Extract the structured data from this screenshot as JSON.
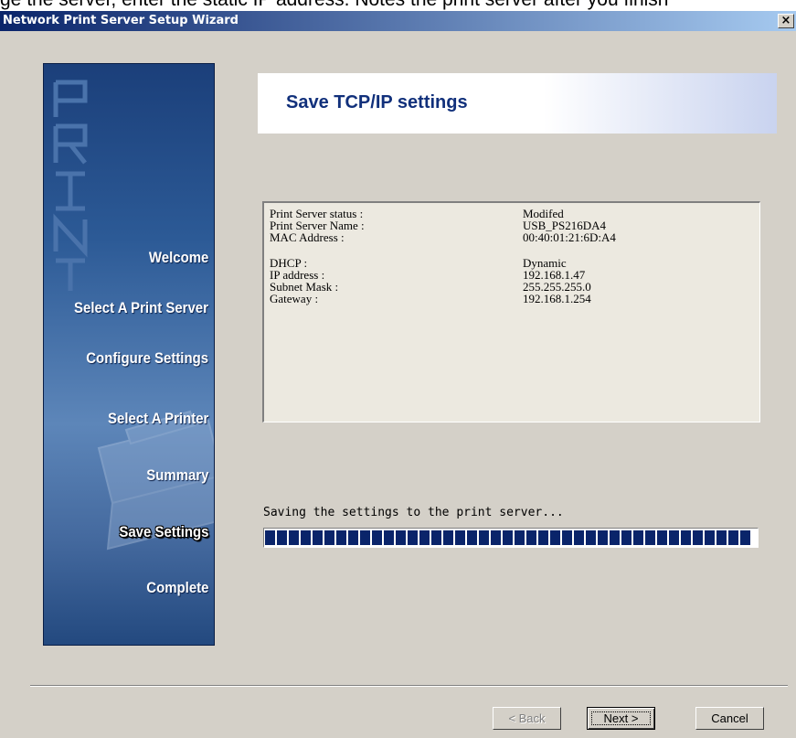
{
  "doc_snippet": "ge the server, enter the static IP address. Notes the print server after you finish",
  "window": {
    "title": "Network Print Server Setup Wizard",
    "close_glyph": "×"
  },
  "sidebar": {
    "watermark": "PRINT",
    "items": [
      {
        "label": "Welcome",
        "active": false
      },
      {
        "label": "Select A Print Server",
        "active": false
      },
      {
        "label": "Configure Settings",
        "active": false
      },
      {
        "label": "Select  A  Printer",
        "active": false
      },
      {
        "label": "Summary",
        "active": false
      },
      {
        "label": "Save Settings",
        "active": true
      },
      {
        "label": "Complete",
        "active": false
      }
    ]
  },
  "header": {
    "title": "Save TCP/IP settings"
  },
  "info": {
    "rows": [
      {
        "key": "Print Server status :",
        "value": "Modifed"
      },
      {
        "key": "Print Server Name :",
        "value": "USB_PS216DA4"
      },
      {
        "key": "MAC Address :",
        "value": "00:40:01:21:6D:A4"
      },
      {
        "key": "DHCP :",
        "value": "Dynamic"
      },
      {
        "key": "IP address :",
        "value": "192.168.1.47"
      },
      {
        "key": "Subnet Mask :",
        "value": "255.255.255.0"
      },
      {
        "key": "Gateway :",
        "value": "192.168.1.254"
      }
    ]
  },
  "status": {
    "text": "Saving the settings to the print server..."
  },
  "progress": {
    "percent": 100,
    "color": "#0a246a"
  },
  "buttons": {
    "back": "< Back",
    "next": "Next >",
    "cancel": "Cancel"
  },
  "colors": {
    "title_bar": "#0a246a",
    "header_text": "#11307b",
    "sidebar": "#2c5a96"
  }
}
